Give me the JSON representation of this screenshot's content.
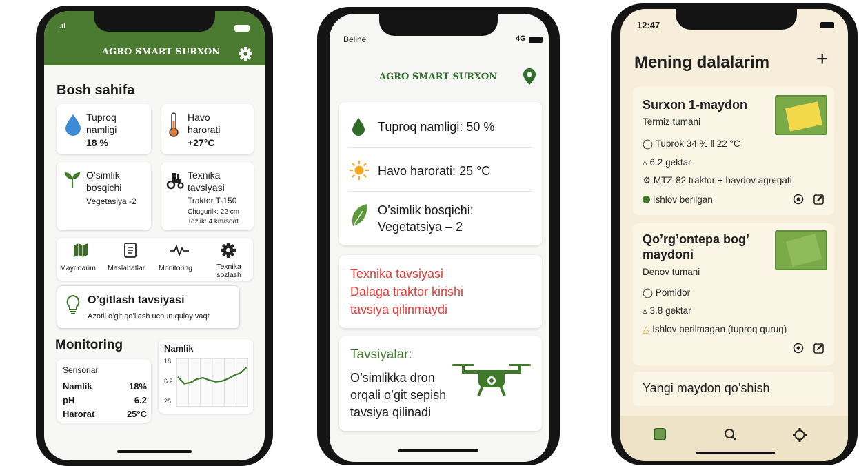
{
  "p1": {
    "signal": ".ıl",
    "title": "AGRO SMART SURXON",
    "page_title": "Bosh sahifa",
    "soil": {
      "label1": "Tuproq",
      "label2": "namligi",
      "value": "18 %"
    },
    "air": {
      "label1": "Havo",
      "label2": "harorati",
      "value": "+27°C"
    },
    "plant": {
      "label1": "O’simlik",
      "label2": "bosqichi",
      "value": "Vegetasiya -2"
    },
    "tech": {
      "label1": "Texnika",
      "label2": "tavslyasi",
      "model": "Traktor T-150",
      "depth": "Chugurilk: 22 cm",
      "speed": "Tezlik: 4 km/soat"
    },
    "nav": {
      "fields": "Maydoarim",
      "tips": "Maslahatlar",
      "monitoring": "Monitoring",
      "settings1": "Texnika",
      "settings2": "sozlash"
    },
    "fert": {
      "title": "O’gitlash tavsiyasi",
      "subtitle": "Azotli o’git qo’llash uchun qulay vaqt"
    },
    "monitoring_title": "Monitoring",
    "sensors": {
      "title": "Sensorlar",
      "rows": [
        {
          "k": "Namlik",
          "v": "18%"
        },
        {
          "k": "pH",
          "v": "6.2"
        },
        {
          "k": "Harorat",
          "v": "25°C"
        }
      ]
    },
    "chart_data": {
      "type": "line",
      "title": "Namlik",
      "yticks": [
        "18",
        "6.2",
        "25"
      ],
      "values": [
        0.38,
        0.52,
        0.5,
        0.43,
        0.4,
        0.45,
        0.48,
        0.47,
        0.42,
        0.35,
        0.3,
        0.18
      ]
    }
  },
  "p2": {
    "carrier": "Beline",
    "network": "4G",
    "title": "AGRO SMART SURXON",
    "soil": {
      "label": "Tuproq namligi:",
      "value": "50 %"
    },
    "air": {
      "label": "Havo harorati:",
      "value": "25 °C"
    },
    "plant": {
      "label": "O’simlik bosqichi:",
      "value": "Vegetatsiya – 2"
    },
    "tech": {
      "l1": "Texnika tavsiyasi",
      "l2": "Dalaga traktor kirishi",
      "l3": "tavsiya qilinmaydi"
    },
    "rec": {
      "title": "Tavsiyalar:",
      "l1": "O’simlikka dron",
      "l2": "orqali o’git sepish",
      "l3": "tavsiya qilinadi"
    }
  },
  "p3": {
    "time": "12:47",
    "page_title": "Mening dalalarim",
    "add": "+",
    "field1": {
      "name": "Surxon 1-maydon",
      "district": "Termiz tumani",
      "soil": "Tuprok 34 %",
      "temp": "22 °C",
      "area": "6.2 gektar",
      "machine": "MTZ-82 traktor + haydov agregati",
      "status": "Ishlov berilgan"
    },
    "field2": {
      "name1": "Qo’rg’ontepa bog’",
      "name2": "maydoni",
      "district": "Denov tumani",
      "crop": "Pomidor",
      "area": "3.8 gektar",
      "status": "Ishlov berilmagan (tuproq quruq)"
    },
    "new_field": "Yangi maydon qo’shish"
  },
  "colors": {
    "green": "#4a7b31",
    "red": "#e53935",
    "dark_green": "#2f6b28",
    "cream": "#f6eedb"
  }
}
